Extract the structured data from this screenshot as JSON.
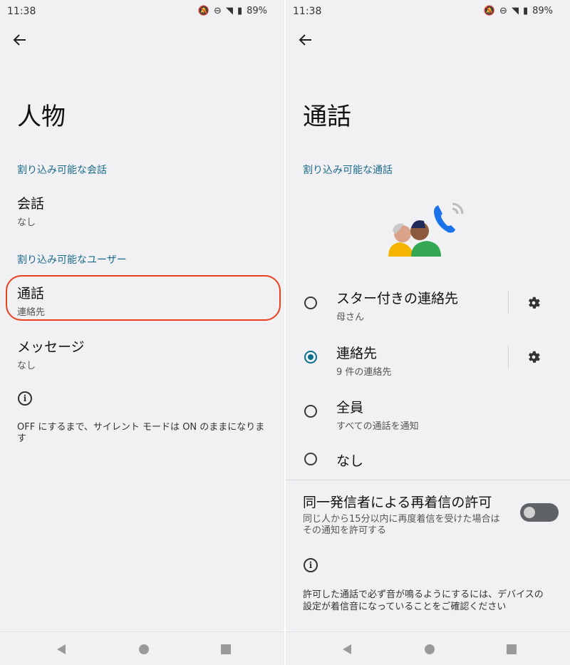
{
  "status": {
    "time": "11:38",
    "battery": "89%"
  },
  "left": {
    "title": "人物",
    "section1": "割り込み可能な会話",
    "conversation": {
      "title": "会話",
      "sub": "なし"
    },
    "section2": "割り込み可能なユーザー",
    "calls": {
      "title": "通話",
      "sub": "連絡先"
    },
    "messages": {
      "title": "メッセージ",
      "sub": "なし"
    },
    "footer": "OFF にするまで、サイレント モードは ON のままになります",
    "highlight_color": "#e8401c"
  },
  "right": {
    "title": "通話",
    "section": "割り込み可能な通話",
    "options": [
      {
        "title": "スター付きの連絡先",
        "sub": "母さん",
        "selected": false
      },
      {
        "title": "連絡先",
        "sub": "9 件の連絡先",
        "selected": true
      },
      {
        "title": "全員",
        "sub": "すべての通話を通知",
        "selected": false
      },
      {
        "title": "なし",
        "sub": "",
        "selected": false
      }
    ],
    "repeat": {
      "title": "同一発信者による再着信の許可",
      "sub_line1": "同じ人から15分以内に再度着信を受けた場合は",
      "sub_line2": "その通知を許可する",
      "enabled": false
    },
    "footer_line1": "許可した通話で必ず音が鳴るようにするには、デバイスの",
    "footer_line2": "設定が着信音になっていることをご確認ください"
  },
  "colors": {
    "accent": "#0b6e8a",
    "section": "#1b6b8a"
  }
}
